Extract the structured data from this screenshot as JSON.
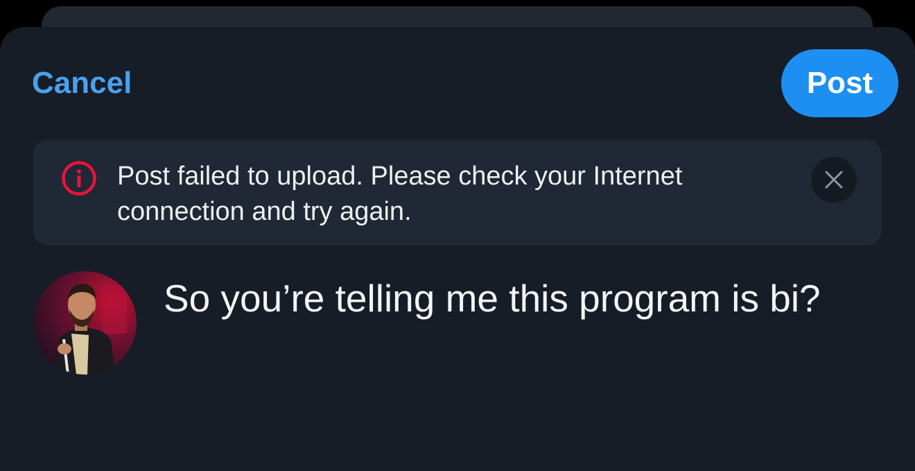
{
  "header": {
    "cancel_label": "Cancel",
    "post_label": "Post"
  },
  "error_banner": {
    "message": "Post failed to upload. Please check your Internet connection and try again.",
    "icon": "info-circle-icon",
    "dismiss_icon": "close-icon"
  },
  "composer": {
    "avatar": "user-avatar",
    "text": "So you’re telling me this program is bi?"
  },
  "colors": {
    "background": "#171d26",
    "accent": "#1d8ff2",
    "link": "#4aa1ee",
    "error": "#e8143c",
    "banner": "#1f2834"
  }
}
